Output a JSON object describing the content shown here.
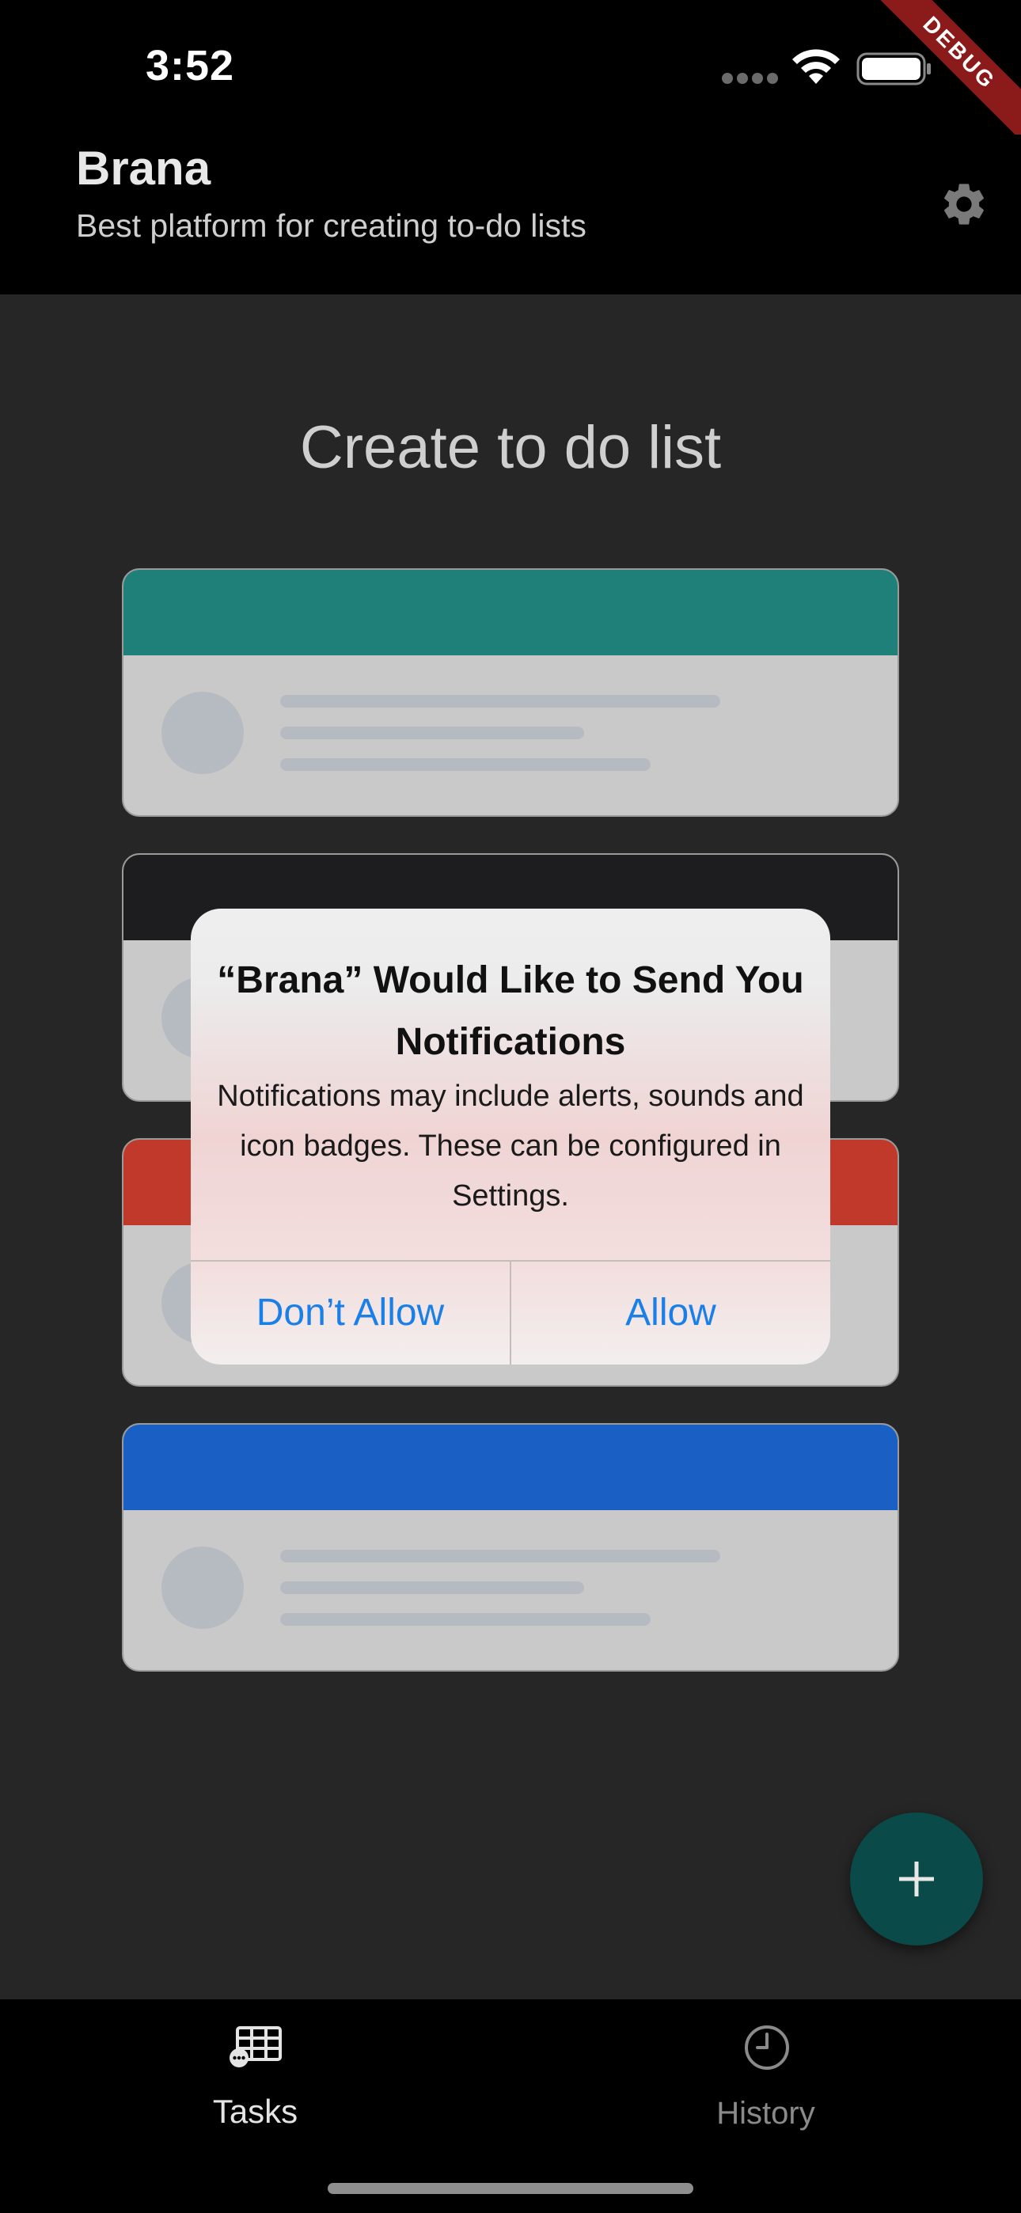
{
  "status_bar": {
    "time": "3:52",
    "debug_label": "DEBUG"
  },
  "app_bar": {
    "title": "Brana",
    "subtitle": "Best platform for creating to-do lists",
    "settings_icon": "gear-icon"
  },
  "main": {
    "title": "Create to do list",
    "cards": [
      {
        "color": "#1f8079"
      },
      {
        "color": "#1d1d1f"
      },
      {
        "color": "#c0392b"
      },
      {
        "color": "#1a5fc4"
      }
    ]
  },
  "dialog": {
    "title": "“Brana” Would Like to Send You Notifications",
    "message": "Notifications may include alerts, sounds and icon badges. These can be configured in Settings.",
    "dont_allow_label": "Don’t Allow",
    "allow_label": "Allow",
    "button_color": "#1a7fe6"
  },
  "fab": {
    "icon": "plus-icon",
    "color": "#0a4a48"
  },
  "bottom_nav": {
    "items": [
      {
        "label": "Tasks",
        "icon": "table-icon",
        "active": true
      },
      {
        "label": "History",
        "icon": "clock-icon",
        "active": false
      }
    ]
  }
}
